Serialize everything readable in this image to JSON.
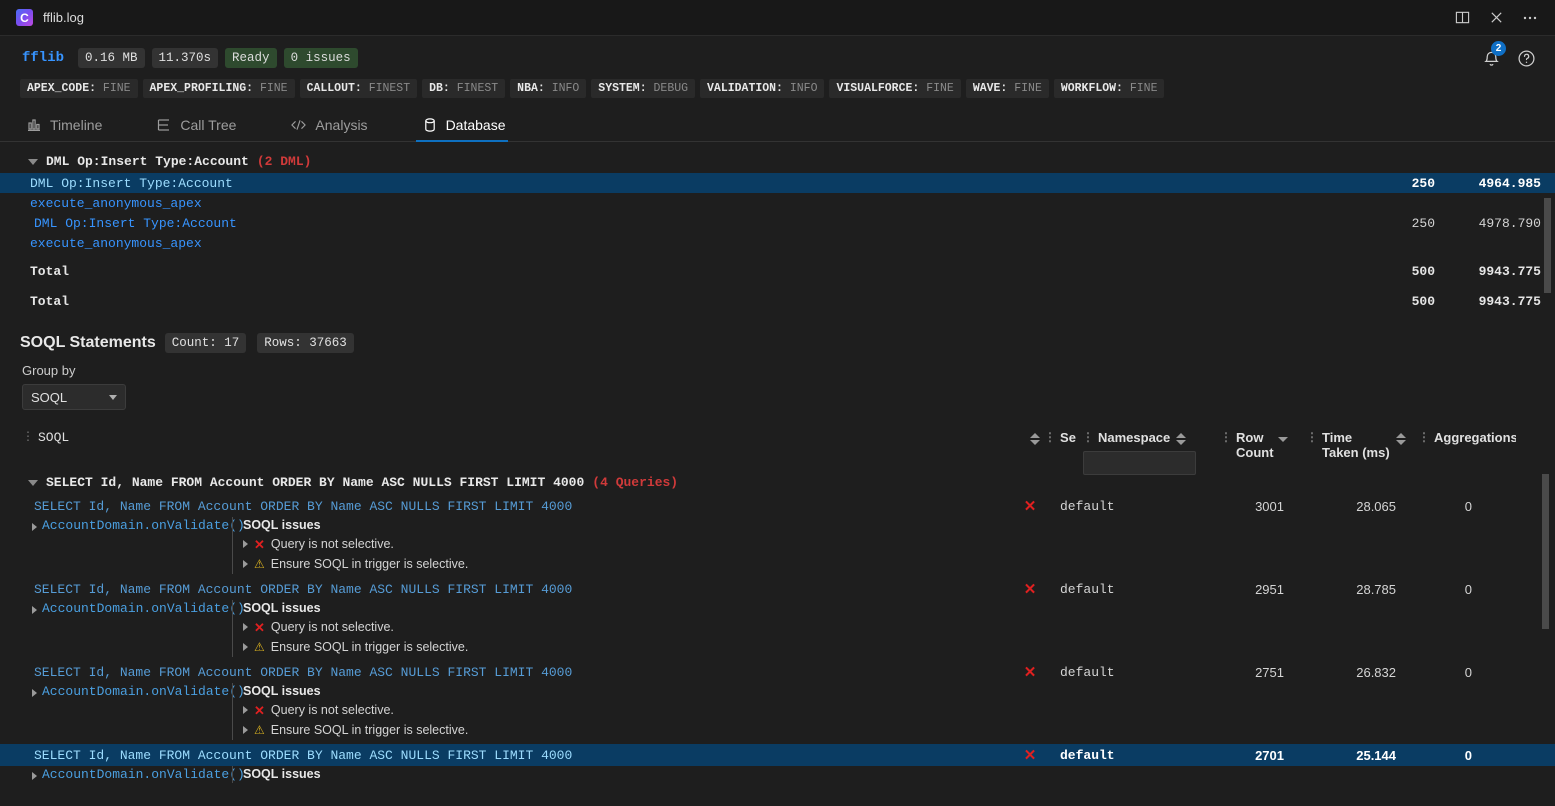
{
  "window": {
    "title": "fflib.log",
    "logo_letter": "C",
    "controls": [
      "split-editor",
      "close",
      "more"
    ]
  },
  "status": {
    "project": "fflib",
    "chips": [
      {
        "label": "0.16 MB",
        "style": "grey"
      },
      {
        "label": "11.370s",
        "style": "grey"
      },
      {
        "label": "Ready",
        "style": "green"
      },
      {
        "label": "0 issues",
        "style": "green"
      }
    ],
    "notification_count": "2"
  },
  "log_levels": [
    {
      "key": "APEX_CODE:",
      "value": "FINE"
    },
    {
      "key": "APEX_PROFILING:",
      "value": "FINE"
    },
    {
      "key": "CALLOUT:",
      "value": "FINEST"
    },
    {
      "key": "DB:",
      "value": "FINEST"
    },
    {
      "key": "NBA:",
      "value": "INFO"
    },
    {
      "key": "SYSTEM:",
      "value": "DEBUG"
    },
    {
      "key": "VALIDATION:",
      "value": "INFO"
    },
    {
      "key": "VISUALFORCE:",
      "value": "FINE"
    },
    {
      "key": "WAVE:",
      "value": "FINE"
    },
    {
      "key": "WORKFLOW:",
      "value": "FINE"
    }
  ],
  "tabs": [
    {
      "label": "Timeline",
      "icon": "chart-bar-icon",
      "active": false
    },
    {
      "label": "Call Tree",
      "icon": "tree-list-icon",
      "active": false
    },
    {
      "label": "Analysis",
      "icon": "code-brackets-icon",
      "active": false
    },
    {
      "label": "Database",
      "icon": "database-icon",
      "active": true
    }
  ],
  "dml": {
    "group_label": "DML Op:Insert Type:Account",
    "group_count": "(2 DML)",
    "rows": [
      {
        "name": "DML Op:Insert Type:Account",
        "rowcount": "250",
        "time": "4964.985",
        "selected": true,
        "link": true,
        "indent": false
      },
      {
        "name": "execute_anonymous_apex",
        "rowcount": "",
        "time": "",
        "selected": false,
        "link": true,
        "indent": false
      },
      {
        "name": "DML Op:Insert Type:Account",
        "rowcount": "250",
        "time": "4978.790",
        "selected": false,
        "link": true,
        "indent": true
      },
      {
        "name": "execute_anonymous_apex",
        "rowcount": "",
        "time": "",
        "selected": false,
        "link": true,
        "indent": false
      },
      {
        "name": "Total",
        "rowcount": "500",
        "time": "9943.775",
        "selected": false,
        "link": false,
        "indent": false,
        "bold": true
      },
      {
        "name": "Total",
        "rowcount": "500",
        "time": "9943.775",
        "selected": false,
        "link": false,
        "indent": false,
        "bold": true
      }
    ]
  },
  "soql": {
    "title": "SOQL Statements",
    "count_chip": "Count: 17",
    "rows_chip": "Rows: 37663",
    "groupby_label": "Group by",
    "groupby_value": "SOQL",
    "columns": [
      {
        "label": "SOQL",
        "key": "soql"
      },
      {
        "label": "Se",
        "key": "selective"
      },
      {
        "label": "Namespace",
        "key": "namespace"
      },
      {
        "label": "Row Count",
        "line1": "Row",
        "line2": "Count",
        "key": "row_count"
      },
      {
        "label": "Time Taken (ms)",
        "line1": "Time",
        "line2": "Taken (ms)",
        "key": "time_taken"
      },
      {
        "label": "Aggregations",
        "key": "aggregations"
      }
    ],
    "namespace_filter_value": "",
    "group": {
      "label": "SELECT Id, Name FROM Account ORDER BY Name ASC NULLS FIRST LIMIT 4000",
      "count": "(4 Queries)"
    },
    "queries": [
      {
        "sql": "SELECT Id, Name FROM Account ORDER BY Name ASC NULLS FIRST LIMIT 4000",
        "selective": "x",
        "namespace": "default",
        "row_count": "3001",
        "time_taken": "28.065",
        "aggregations": "0",
        "selected": false,
        "stack": "AccountDomain.onValidate()",
        "issues_title": "SOQL issues",
        "issues": [
          {
            "icon": "error",
            "text": "Query is not selective."
          },
          {
            "icon": "warning",
            "text": "Ensure SOQL in trigger is selective."
          }
        ]
      },
      {
        "sql": "SELECT Id, Name FROM Account ORDER BY Name ASC NULLS FIRST LIMIT 4000",
        "selective": "x",
        "namespace": "default",
        "row_count": "2951",
        "time_taken": "28.785",
        "aggregations": "0",
        "selected": false,
        "stack": "AccountDomain.onValidate()",
        "issues_title": "SOQL issues",
        "issues": [
          {
            "icon": "error",
            "text": "Query is not selective."
          },
          {
            "icon": "warning",
            "text": "Ensure SOQL in trigger is selective."
          }
        ]
      },
      {
        "sql": "SELECT Id, Name FROM Account ORDER BY Name ASC NULLS FIRST LIMIT 4000",
        "selective": "x",
        "namespace": "default",
        "row_count": "2751",
        "time_taken": "26.832",
        "aggregations": "0",
        "selected": false,
        "stack": "AccountDomain.onValidate()",
        "issues_title": "SOQL issues",
        "issues": [
          {
            "icon": "error",
            "text": "Query is not selective."
          },
          {
            "icon": "warning",
            "text": "Ensure SOQL in trigger is selective."
          }
        ]
      },
      {
        "sql": "SELECT Id, Name FROM Account ORDER BY Name ASC NULLS FIRST LIMIT 4000",
        "selective": "x",
        "namespace": "default",
        "row_count": "2701",
        "time_taken": "25.144",
        "aggregations": "0",
        "selected": true,
        "stack": "AccountDomain.onValidate()",
        "issues_title": "SOQL issues",
        "issues": []
      }
    ]
  },
  "colors": {
    "background": "#1e1e1e",
    "selection": "#0a3c63",
    "accent": "#3794ff",
    "error": "#e02020",
    "warning": "#d8b020",
    "chip_green": "#2e4a2e",
    "tab_active_underline": "#0e70c0"
  }
}
